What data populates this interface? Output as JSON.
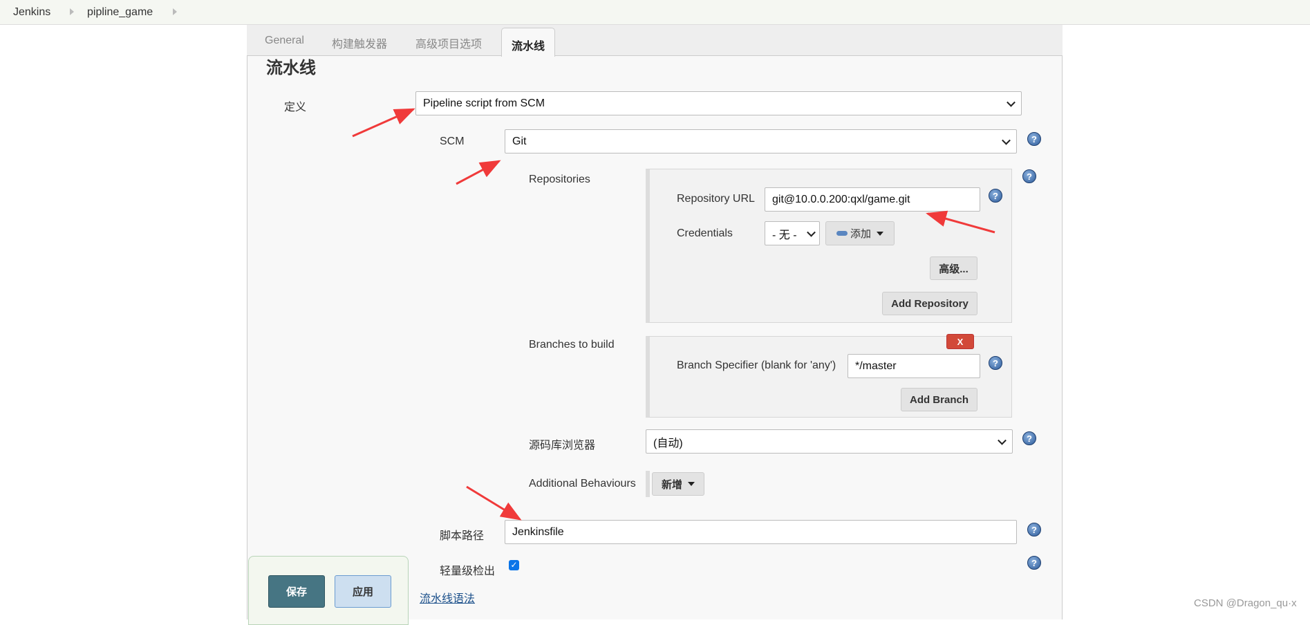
{
  "breadcrumb": [
    "Jenkins",
    "pipline_game"
  ],
  "tabs": [
    "General",
    "构建触发器",
    "高级项目选项",
    "流水线"
  ],
  "active_tab": "流水线",
  "section_title": "流水线",
  "definition": {
    "label": "定义",
    "value": "Pipeline script from SCM"
  },
  "scm": {
    "label": "SCM",
    "value": "Git"
  },
  "repositories": {
    "label": "Repositories",
    "url_label": "Repository URL",
    "url_value": "git@10.0.0.200:qxl/game.git",
    "cred_label": "Credentials",
    "cred_value": "- 无 -",
    "add_label": "添加",
    "advanced_label": "高级...",
    "add_repo_label": "Add Repository"
  },
  "branches": {
    "label": "Branches to build",
    "delete_label": "X",
    "spec_label": "Branch Specifier (blank for 'any')",
    "spec_value": "*/master",
    "add_branch_label": "Add Branch"
  },
  "browser": {
    "label": "源码库浏览器",
    "value": "(自动)"
  },
  "behaviours": {
    "label": "Additional Behaviours",
    "add_label": "新增"
  },
  "script_path": {
    "label": "脚本路径",
    "value": "Jenkinsfile"
  },
  "lightweight": {
    "label": "轻量级检出",
    "checked": true
  },
  "syntax_link": "流水线语法",
  "buttons": {
    "save": "保存",
    "apply": "应用"
  },
  "help_icon": "?",
  "watermark": "CSDN @Dragon_qu·x",
  "colors": {
    "save_bg": "#467583",
    "apply_bg": "#cddff0",
    "delete_bg": "#d24939",
    "annotation_arrow": "#f03a3a",
    "help_blue": "#2d5b9a"
  }
}
